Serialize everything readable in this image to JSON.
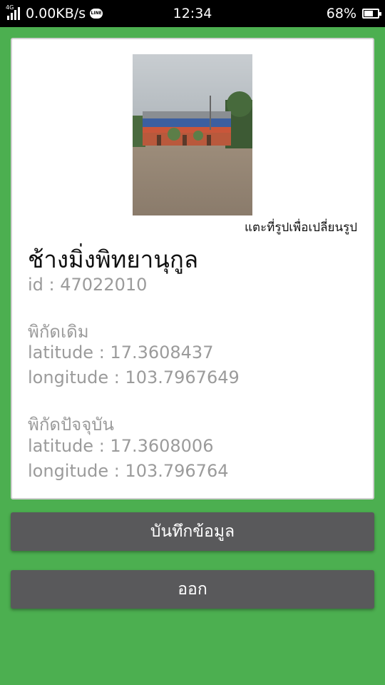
{
  "status_bar": {
    "network_type": "4G",
    "speed": "0.00KB/s",
    "app_icon": "line-icon",
    "app_icon_text": "LINE",
    "time": "12:34",
    "battery_percent": "68%",
    "battery_level": 0.68
  },
  "card": {
    "photo_hint": "แตะที่รูปเพื่อเปลี่ยนรูป",
    "school_name": "ช้างมิ่งพิทยานุกูล",
    "id_text": "id : 47022010",
    "original_coords": {
      "label": "พิกัดเดิม",
      "latitude": "latitude : 17.3608437",
      "longitude": "longitude : 103.7967649"
    },
    "current_coords": {
      "label": "พิกัดปัจจุบัน",
      "latitude": "latitude : 17.3608006",
      "longitude": "longitude : 103.796764"
    }
  },
  "buttons": {
    "save_label": "บันทึกข้อมูล",
    "exit_label": "ออก"
  },
  "colors": {
    "background": "#4caf50",
    "button": "#59595b",
    "secondary_text": "#9b9b9b"
  }
}
